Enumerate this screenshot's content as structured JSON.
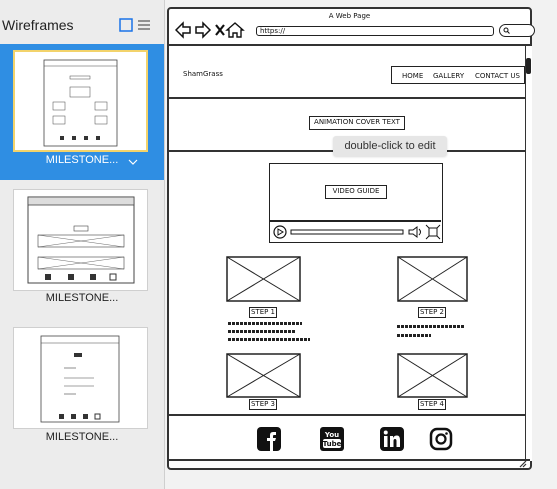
{
  "sidebar": {
    "title": "Wireframes",
    "icons": [
      "grid-view-icon",
      "list-view-icon"
    ],
    "items": [
      {
        "label": "MILESTONE...",
        "selected": true
      },
      {
        "label": "MILESTONE...",
        "selected": false
      },
      {
        "label": "MILESTONE...",
        "selected": false
      }
    ]
  },
  "browser": {
    "title": "A Web Page",
    "url": "https://"
  },
  "site": {
    "brand": "ShamGrass",
    "nav": [
      "HOME",
      "GALLERY",
      "CONTACT US"
    ],
    "cover_text": "ANIMATION COVER TEXT",
    "video_label": "VIDEO GUIDE",
    "steps": [
      "STEP 1",
      "STEP 2",
      "STEP 3",
      "STEP 4"
    ],
    "social_icons": [
      "facebook-icon",
      "youtube-icon",
      "linkedin-icon",
      "instagram-icon"
    ],
    "youtube_text": [
      "You",
      "Tube"
    ]
  },
  "tooltip": "double-click to edit",
  "colors": {
    "selection": "#2f8ee3",
    "accent": "#1a73e8",
    "highlight_border": "#f3d36b"
  }
}
